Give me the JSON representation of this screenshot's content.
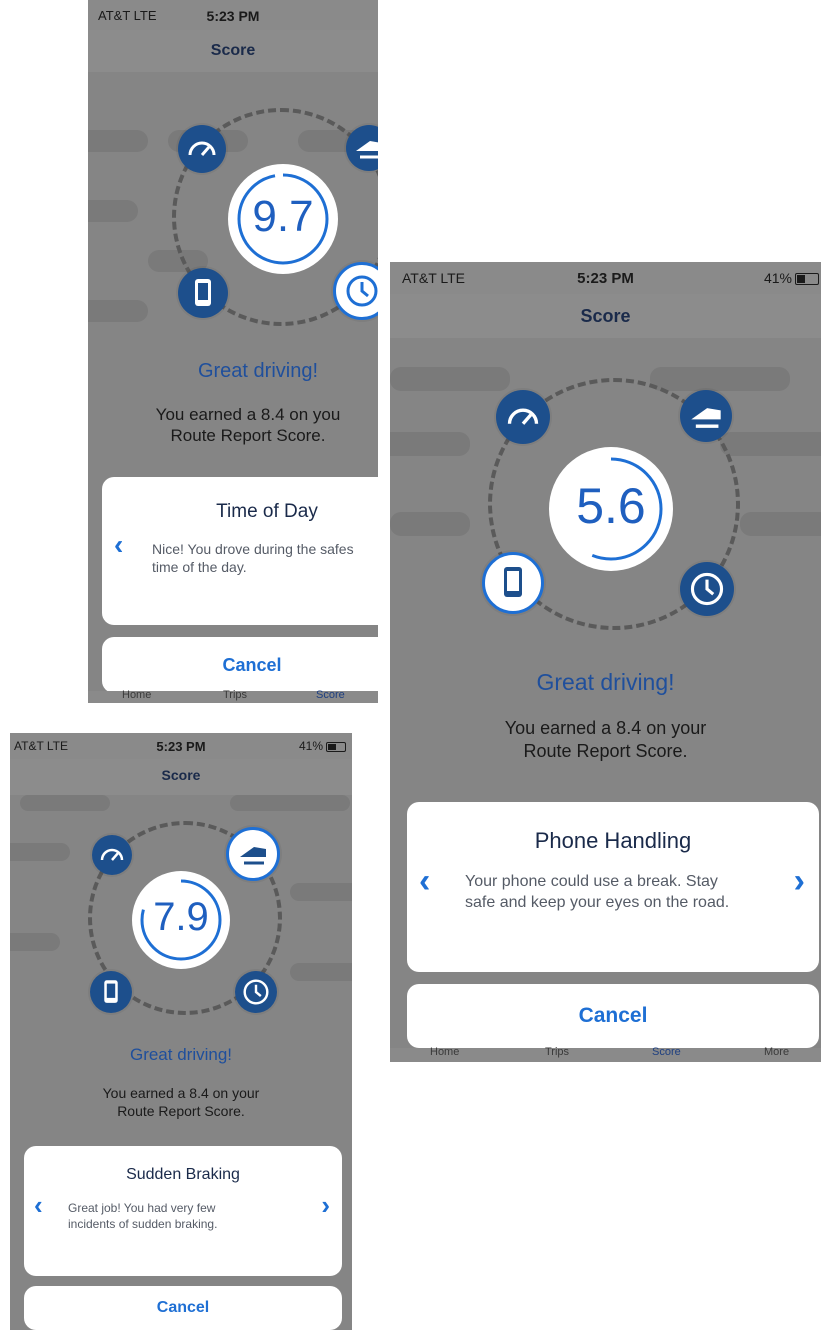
{
  "status": {
    "carrier": "AT&T  LTE",
    "time": "5:23 PM",
    "battery": "41%"
  },
  "nav_title": "Score",
  "great_text": "Great driving!",
  "earned_line1": "You earned a 8.4 on your",
  "earned_line2": "Route Report Score.",
  "earned_line1_short": "You earned a 8.4 on you",
  "cancel_label": "Cancel",
  "tabs": {
    "home": "Home",
    "trips": "Trips",
    "score": "Score",
    "more": "More"
  },
  "screens": [
    {
      "score": "9.7",
      "card_title": "Time of Day",
      "card_text": "Nice! You drove during the safest time of the day.",
      "card_line1": "Nice! You drove during the safes",
      "card_line2": "time of the day.",
      "score_fraction": 0.97
    },
    {
      "score": "5.6",
      "card_title": "Phone Handling",
      "card_line1": "Your phone could use a break. Stay",
      "card_line2": "safe and keep your eyes on the road.",
      "score_fraction": 0.56
    },
    {
      "score": "7.9",
      "card_title": "Sudden Braking",
      "card_line1": "Great job! You had very few",
      "card_line2": "incidents of sudden braking.",
      "score_fraction": 0.79
    }
  ],
  "colors": {
    "accent": "#1e6fd4",
    "icon_bg": "#1d4f8c",
    "score_text": "#1f5fbf"
  }
}
